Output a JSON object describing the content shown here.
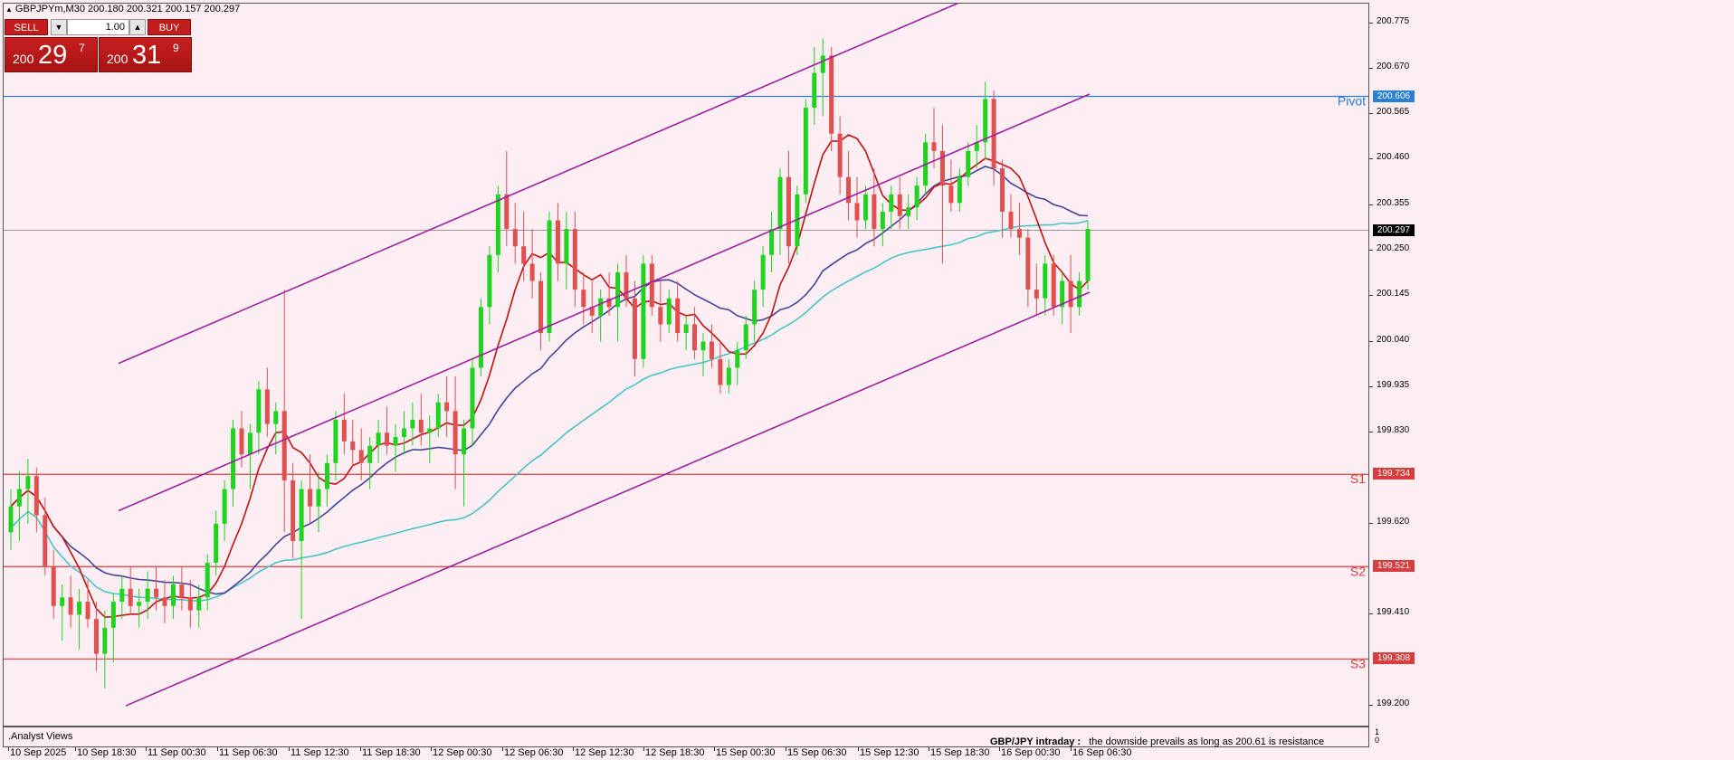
{
  "symbol": {
    "name": "GBPJPYm,M30",
    "open": "200.180",
    "high": "200.321",
    "low": "200.157",
    "close": "200.297"
  },
  "trade_panel": {
    "sell_label": "SELL",
    "buy_label": "BUY",
    "lot": "1.00",
    "sell_price": {
      "prefix": "200",
      "big": "29",
      "sup": "7"
    },
    "buy_price": {
      "prefix": "200",
      "big": "31",
      "sup": "9"
    }
  },
  "price_axis": {
    "ticks": [
      "200.775",
      "200.670",
      "200.565",
      "200.460",
      "200.355",
      "200.250",
      "200.145",
      "200.040",
      "199.935",
      "199.830",
      "199.620",
      "199.410",
      "199.200"
    ],
    "current_price": "200.297"
  },
  "levels": [
    {
      "name": "Pivot",
      "value": "200.606",
      "color": "#2a7fd6"
    },
    {
      "name": "S1",
      "value": "199.734",
      "color": "#d93c3c"
    },
    {
      "name": "S2",
      "value": "199.521",
      "color": "#d93c3c"
    },
    {
      "name": "S3",
      "value": "199.308",
      "color": "#d93c3c"
    }
  ],
  "time_axis": [
    "10 Sep 2025",
    "10 Sep 18:30",
    "11 Sep 00:30",
    "11 Sep 06:30",
    "11 Sep 12:30",
    "11 Sep 18:30",
    "12 Sep 00:30",
    "12 Sep 06:30",
    "12 Sep 12:30",
    "12 Sep 18:30",
    "15 Sep 00:30",
    "15 Sep 06:30",
    "15 Sep 12:30",
    "15 Sep 18:30",
    "16 Sep 00:30",
    "16 Sep 06:30"
  ],
  "bottom_panel": {
    "label": ".Analyst Views",
    "headline": "GBP/JPY intraday :",
    "text": "the downside prevails as long as 200.61 is resistance",
    "axis_top": "1",
    "axis_bottom": "0"
  },
  "chart_data": {
    "type": "candlestick",
    "symbol": "GBPJPYm",
    "timeframe": "M30",
    "ylim": [
      199.15,
      200.82
    ],
    "bull_color": "#1ed41e",
    "bear_color": "#e05050",
    "candles": [
      [
        199.6,
        199.7,
        199.56,
        199.66
      ],
      [
        199.66,
        199.74,
        199.58,
        199.7
      ],
      [
        199.7,
        199.77,
        199.62,
        199.73
      ],
      [
        199.73,
        199.75,
        199.6,
        199.64
      ],
      [
        199.64,
        199.68,
        199.5,
        199.52
      ],
      [
        199.52,
        199.56,
        199.4,
        199.43
      ],
      [
        199.43,
        199.48,
        199.35,
        199.45
      ],
      [
        199.45,
        199.5,
        199.38,
        199.41
      ],
      [
        199.41,
        199.47,
        199.33,
        199.44
      ],
      [
        199.44,
        199.49,
        199.38,
        199.4
      ],
      [
        199.4,
        199.44,
        199.28,
        199.32
      ],
      [
        199.32,
        199.42,
        199.24,
        199.38
      ],
      [
        199.38,
        199.46,
        199.3,
        199.44
      ],
      [
        199.44,
        199.5,
        199.4,
        199.47
      ],
      [
        199.47,
        199.52,
        199.41,
        199.43
      ],
      [
        199.43,
        199.47,
        199.38,
        199.44
      ],
      [
        199.44,
        199.51,
        199.4,
        199.47
      ],
      [
        199.47,
        199.52,
        199.42,
        199.45
      ],
      [
        199.45,
        199.49,
        199.39,
        199.43
      ],
      [
        199.43,
        199.5,
        199.4,
        199.48
      ],
      [
        199.48,
        199.52,
        199.42,
        199.45
      ],
      [
        199.45,
        199.49,
        199.38,
        199.42
      ],
      [
        199.42,
        199.48,
        199.38,
        199.45
      ],
      [
        199.45,
        199.55,
        199.42,
        199.53
      ],
      [
        199.53,
        199.65,
        199.5,
        199.62
      ],
      [
        199.62,
        199.72,
        199.58,
        199.7
      ],
      [
        199.7,
        199.86,
        199.66,
        199.84
      ],
      [
        199.84,
        199.88,
        199.75,
        199.78
      ],
      [
        199.78,
        199.85,
        199.7,
        199.83
      ],
      [
        199.83,
        199.95,
        199.78,
        199.93
      ],
      [
        199.93,
        199.98,
        199.82,
        199.85
      ],
      [
        199.85,
        199.9,
        199.78,
        199.88
      ],
      [
        199.88,
        200.16,
        199.6,
        199.72
      ],
      [
        199.72,
        199.76,
        199.54,
        199.58
      ],
      [
        199.58,
        199.72,
        199.4,
        199.7
      ],
      [
        199.7,
        199.78,
        199.62,
        199.66
      ],
      [
        199.66,
        199.74,
        199.6,
        199.7
      ],
      [
        199.7,
        199.78,
        199.66,
        199.76
      ],
      [
        199.76,
        199.88,
        199.72,
        199.86
      ],
      [
        199.86,
        199.92,
        199.78,
        199.81
      ],
      [
        199.81,
        199.86,
        199.75,
        199.79
      ],
      [
        199.79,
        199.84,
        199.72,
        199.76
      ],
      [
        199.76,
        199.82,
        199.7,
        199.8
      ],
      [
        199.8,
        199.86,
        199.76,
        199.83
      ],
      [
        199.83,
        199.89,
        199.78,
        199.8
      ],
      [
        199.8,
        199.85,
        199.74,
        199.82
      ],
      [
        199.82,
        199.88,
        199.78,
        199.84
      ],
      [
        199.84,
        199.9,
        199.8,
        199.86
      ],
      [
        199.86,
        199.92,
        199.8,
        199.83
      ],
      [
        199.83,
        199.87,
        199.76,
        199.84
      ],
      [
        199.84,
        199.92,
        199.82,
        199.9
      ],
      [
        199.9,
        199.96,
        199.82,
        199.88
      ],
      [
        199.88,
        199.96,
        199.7,
        199.78
      ],
      [
        199.78,
        199.86,
        199.66,
        199.84
      ],
      [
        199.84,
        200.0,
        199.8,
        199.98
      ],
      [
        199.98,
        200.14,
        199.96,
        200.12
      ],
      [
        200.12,
        200.26,
        200.08,
        200.24
      ],
      [
        200.24,
        200.4,
        200.2,
        200.38
      ],
      [
        200.38,
        200.48,
        200.26,
        200.3
      ],
      [
        200.3,
        200.36,
        200.22,
        200.26
      ],
      [
        200.26,
        200.34,
        200.18,
        200.22
      ],
      [
        200.22,
        200.3,
        200.14,
        200.18
      ],
      [
        200.18,
        200.2,
        200.02,
        200.06
      ],
      [
        200.06,
        200.34,
        200.04,
        200.32
      ],
      [
        200.32,
        200.36,
        200.18,
        200.22
      ],
      [
        200.22,
        200.34,
        200.16,
        200.3
      ],
      [
        200.3,
        200.34,
        200.12,
        200.16
      ],
      [
        200.16,
        200.2,
        200.08,
        200.12
      ],
      [
        200.12,
        200.18,
        200.06,
        200.1
      ],
      [
        200.1,
        200.16,
        200.04,
        200.14
      ],
      [
        200.14,
        200.2,
        200.1,
        200.12
      ],
      [
        200.12,
        200.22,
        200.04,
        200.2
      ],
      [
        200.2,
        200.24,
        200.12,
        200.14
      ],
      [
        200.14,
        200.18,
        199.96,
        200.0
      ],
      [
        200.0,
        200.24,
        199.98,
        200.22
      ],
      [
        200.22,
        200.24,
        200.1,
        200.12
      ],
      [
        200.12,
        200.18,
        200.04,
        200.08
      ],
      [
        200.08,
        200.16,
        200.06,
        200.14
      ],
      [
        200.14,
        200.18,
        200.04,
        200.06
      ],
      [
        200.06,
        200.1,
        200.02,
        200.08
      ],
      [
        200.08,
        200.12,
        200.0,
        200.02
      ],
      [
        200.02,
        200.06,
        199.96,
        200.04
      ],
      [
        200.04,
        200.08,
        199.98,
        200.0
      ],
      [
        200.0,
        200.04,
        199.92,
        199.94
      ],
      [
        199.94,
        200.0,
        199.92,
        199.98
      ],
      [
        199.98,
        200.04,
        199.94,
        200.02
      ],
      [
        200.02,
        200.1,
        200.0,
        200.08
      ],
      [
        200.08,
        200.18,
        200.04,
        200.16
      ],
      [
        200.16,
        200.26,
        200.12,
        200.24
      ],
      [
        200.24,
        200.34,
        200.2,
        200.3
      ],
      [
        200.3,
        200.44,
        200.24,
        200.42
      ],
      [
        200.42,
        200.48,
        200.22,
        200.26
      ],
      [
        200.26,
        200.4,
        200.24,
        200.38
      ],
      [
        200.38,
        200.6,
        200.36,
        200.58
      ],
      [
        200.58,
        200.72,
        200.54,
        200.66
      ],
      [
        200.66,
        200.74,
        200.56,
        200.7
      ],
      [
        200.7,
        200.72,
        200.48,
        200.52
      ],
      [
        200.52,
        200.56,
        200.38,
        200.42
      ],
      [
        200.42,
        200.48,
        200.32,
        200.36
      ],
      [
        200.36,
        200.42,
        200.28,
        200.32
      ],
      [
        200.32,
        200.4,
        200.3,
        200.38
      ],
      [
        200.38,
        200.44,
        200.26,
        200.3
      ],
      [
        200.3,
        200.36,
        200.26,
        200.34
      ],
      [
        200.34,
        200.4,
        200.3,
        200.38
      ],
      [
        200.38,
        200.42,
        200.3,
        200.33
      ],
      [
        200.33,
        200.38,
        200.3,
        200.35
      ],
      [
        200.35,
        200.42,
        200.32,
        200.4
      ],
      [
        200.4,
        200.52,
        200.38,
        200.5
      ],
      [
        200.5,
        200.58,
        200.44,
        200.48
      ],
      [
        200.48,
        200.54,
        200.22,
        200.4
      ],
      [
        200.4,
        200.46,
        200.34,
        200.36
      ],
      [
        200.36,
        200.44,
        200.34,
        200.42
      ],
      [
        200.42,
        200.5,
        200.4,
        200.48
      ],
      [
        200.48,
        200.54,
        200.44,
        200.5
      ],
      [
        200.5,
        200.64,
        200.46,
        200.6
      ],
      [
        200.6,
        200.62,
        200.4,
        200.44
      ],
      [
        200.44,
        200.46,
        200.28,
        200.34
      ],
      [
        200.34,
        200.38,
        200.28,
        200.3
      ],
      [
        200.3,
        200.36,
        200.24,
        200.28
      ],
      [
        200.28,
        200.3,
        200.12,
        200.16
      ],
      [
        200.16,
        200.22,
        200.1,
        200.14
      ],
      [
        200.14,
        200.24,
        200.1,
        200.22
      ],
      [
        200.22,
        200.24,
        200.1,
        200.12
      ],
      [
        200.12,
        200.2,
        200.08,
        200.18
      ],
      [
        200.18,
        200.24,
        200.06,
        200.12
      ],
      [
        200.12,
        200.2,
        200.1,
        200.18
      ],
      [
        200.18,
        200.32,
        200.16,
        200.3
      ]
    ],
    "ma_fast_color": "#c41010",
    "ma_mid_color": "#44449a",
    "ma_slow_color": "#4bc3c3",
    "channel_color": "#a020a0",
    "level_line_color": "#d93c3c",
    "pivot_line_color": "#2a7fd6",
    "current_line_color": "#888888"
  }
}
